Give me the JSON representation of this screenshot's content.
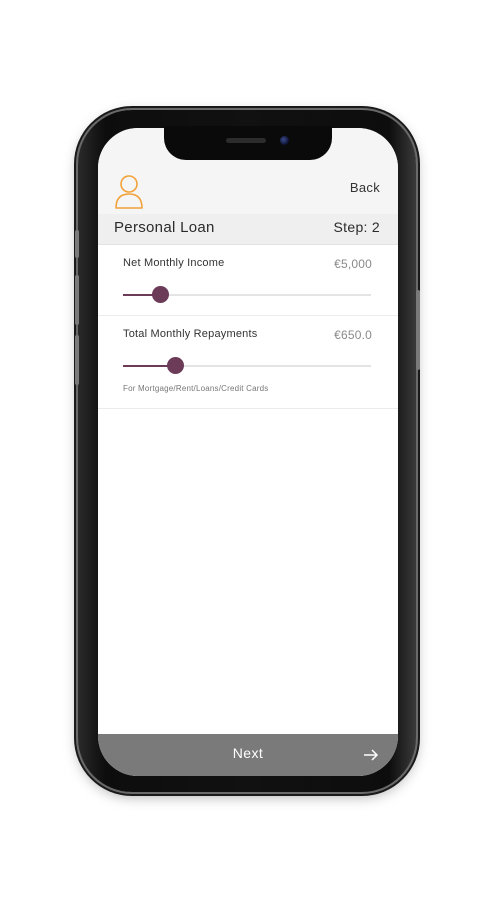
{
  "header": {
    "back_label": "Back",
    "title": "Personal Loan",
    "step_label": "Step: 2",
    "avatar_icon": "user-outline-icon",
    "accent_color": "#f2a23a"
  },
  "fields": [
    {
      "label": "Net Monthly Income",
      "value": "€5,000",
      "slider_fraction": 0.15
    },
    {
      "label": "Total Monthly Repayments",
      "value": "€650.0",
      "slider_fraction": 0.21,
      "helper": "For Mortgage/Rent/Loans/Credit Cards"
    }
  ],
  "slider_color": "#6b3b58",
  "footer": {
    "next_label": "Next",
    "arrow_icon": "arrow-right-icon"
  }
}
